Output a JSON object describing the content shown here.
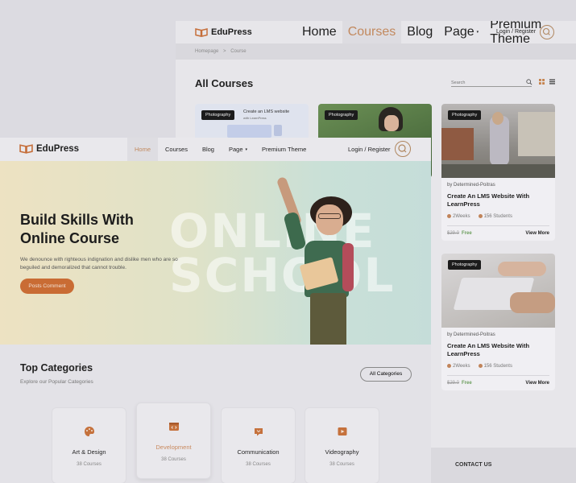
{
  "brand": {
    "name": "EduPress",
    "accent": "#c96c34",
    "free_color": "#6d9f5e"
  },
  "back_window": {
    "nav": [
      {
        "label": "Home",
        "active": false
      },
      {
        "label": "Courses",
        "active": true
      },
      {
        "label": "Blog",
        "active": false
      },
      {
        "label": "Page",
        "active": false,
        "chevron": true
      },
      {
        "label": "Premium Theme",
        "active": false
      }
    ],
    "login": "Login / Register",
    "breadcrumb": {
      "home": "Homepage",
      "sep": ">",
      "current": "Course"
    },
    "title": "All Courses",
    "search_placeholder": "Search",
    "cards": [
      {
        "badge": "Photography",
        "banner": "Create an LMS website",
        "banner_sub": "with LearnPress"
      },
      {
        "badge": "Photography"
      },
      {
        "badge": "Photography",
        "author": "by Determined-Poitras",
        "title": "Create An LMS Website With LearnPress",
        "duration": "2Weeks",
        "students": "156 Students",
        "old_price": "$29.0",
        "price": "Free",
        "more": "View More"
      },
      {
        "badge": "Photography",
        "author": "by Determined-Poitras",
        "title": "Create An LMS Website With LearnPress",
        "duration": "2Weeks",
        "students": "156 Students",
        "old_price": "$29.0",
        "price": "Free",
        "more": "View More"
      }
    ],
    "footer_title": "CONTACT US"
  },
  "front_window": {
    "nav": [
      {
        "label": "Home",
        "active": true
      },
      {
        "label": "Courses",
        "active": false
      },
      {
        "label": "Blog",
        "active": false
      },
      {
        "label": "Page",
        "active": false,
        "chevron": true
      },
      {
        "label": "Premium Theme",
        "active": false
      }
    ],
    "login": "Login / Register",
    "hero": {
      "line1": "Build Skills With",
      "line2": "Online Course",
      "desc": "We denounce with righteous indignation and dislike men who are so beguiled and demoralized that cannot trouble.",
      "cta": "Posts Comment",
      "bg_word1": "ONLINE",
      "bg_word2": "SCHOOL"
    },
    "categories": {
      "title": "Top Categories",
      "subtitle": "Explore our Popular Categories",
      "all_button": "All Categories",
      "items": [
        {
          "name": "Art & Design",
          "count": "38 Courses",
          "icon": "palette-icon"
        },
        {
          "name": "Development",
          "count": "38 Courses",
          "icon": "code-icon",
          "selected": true
        },
        {
          "name": "Communication",
          "count": "38 Courses",
          "icon": "chat-icon"
        },
        {
          "name": "Videography",
          "count": "38 Courses",
          "icon": "video-icon"
        }
      ]
    }
  }
}
